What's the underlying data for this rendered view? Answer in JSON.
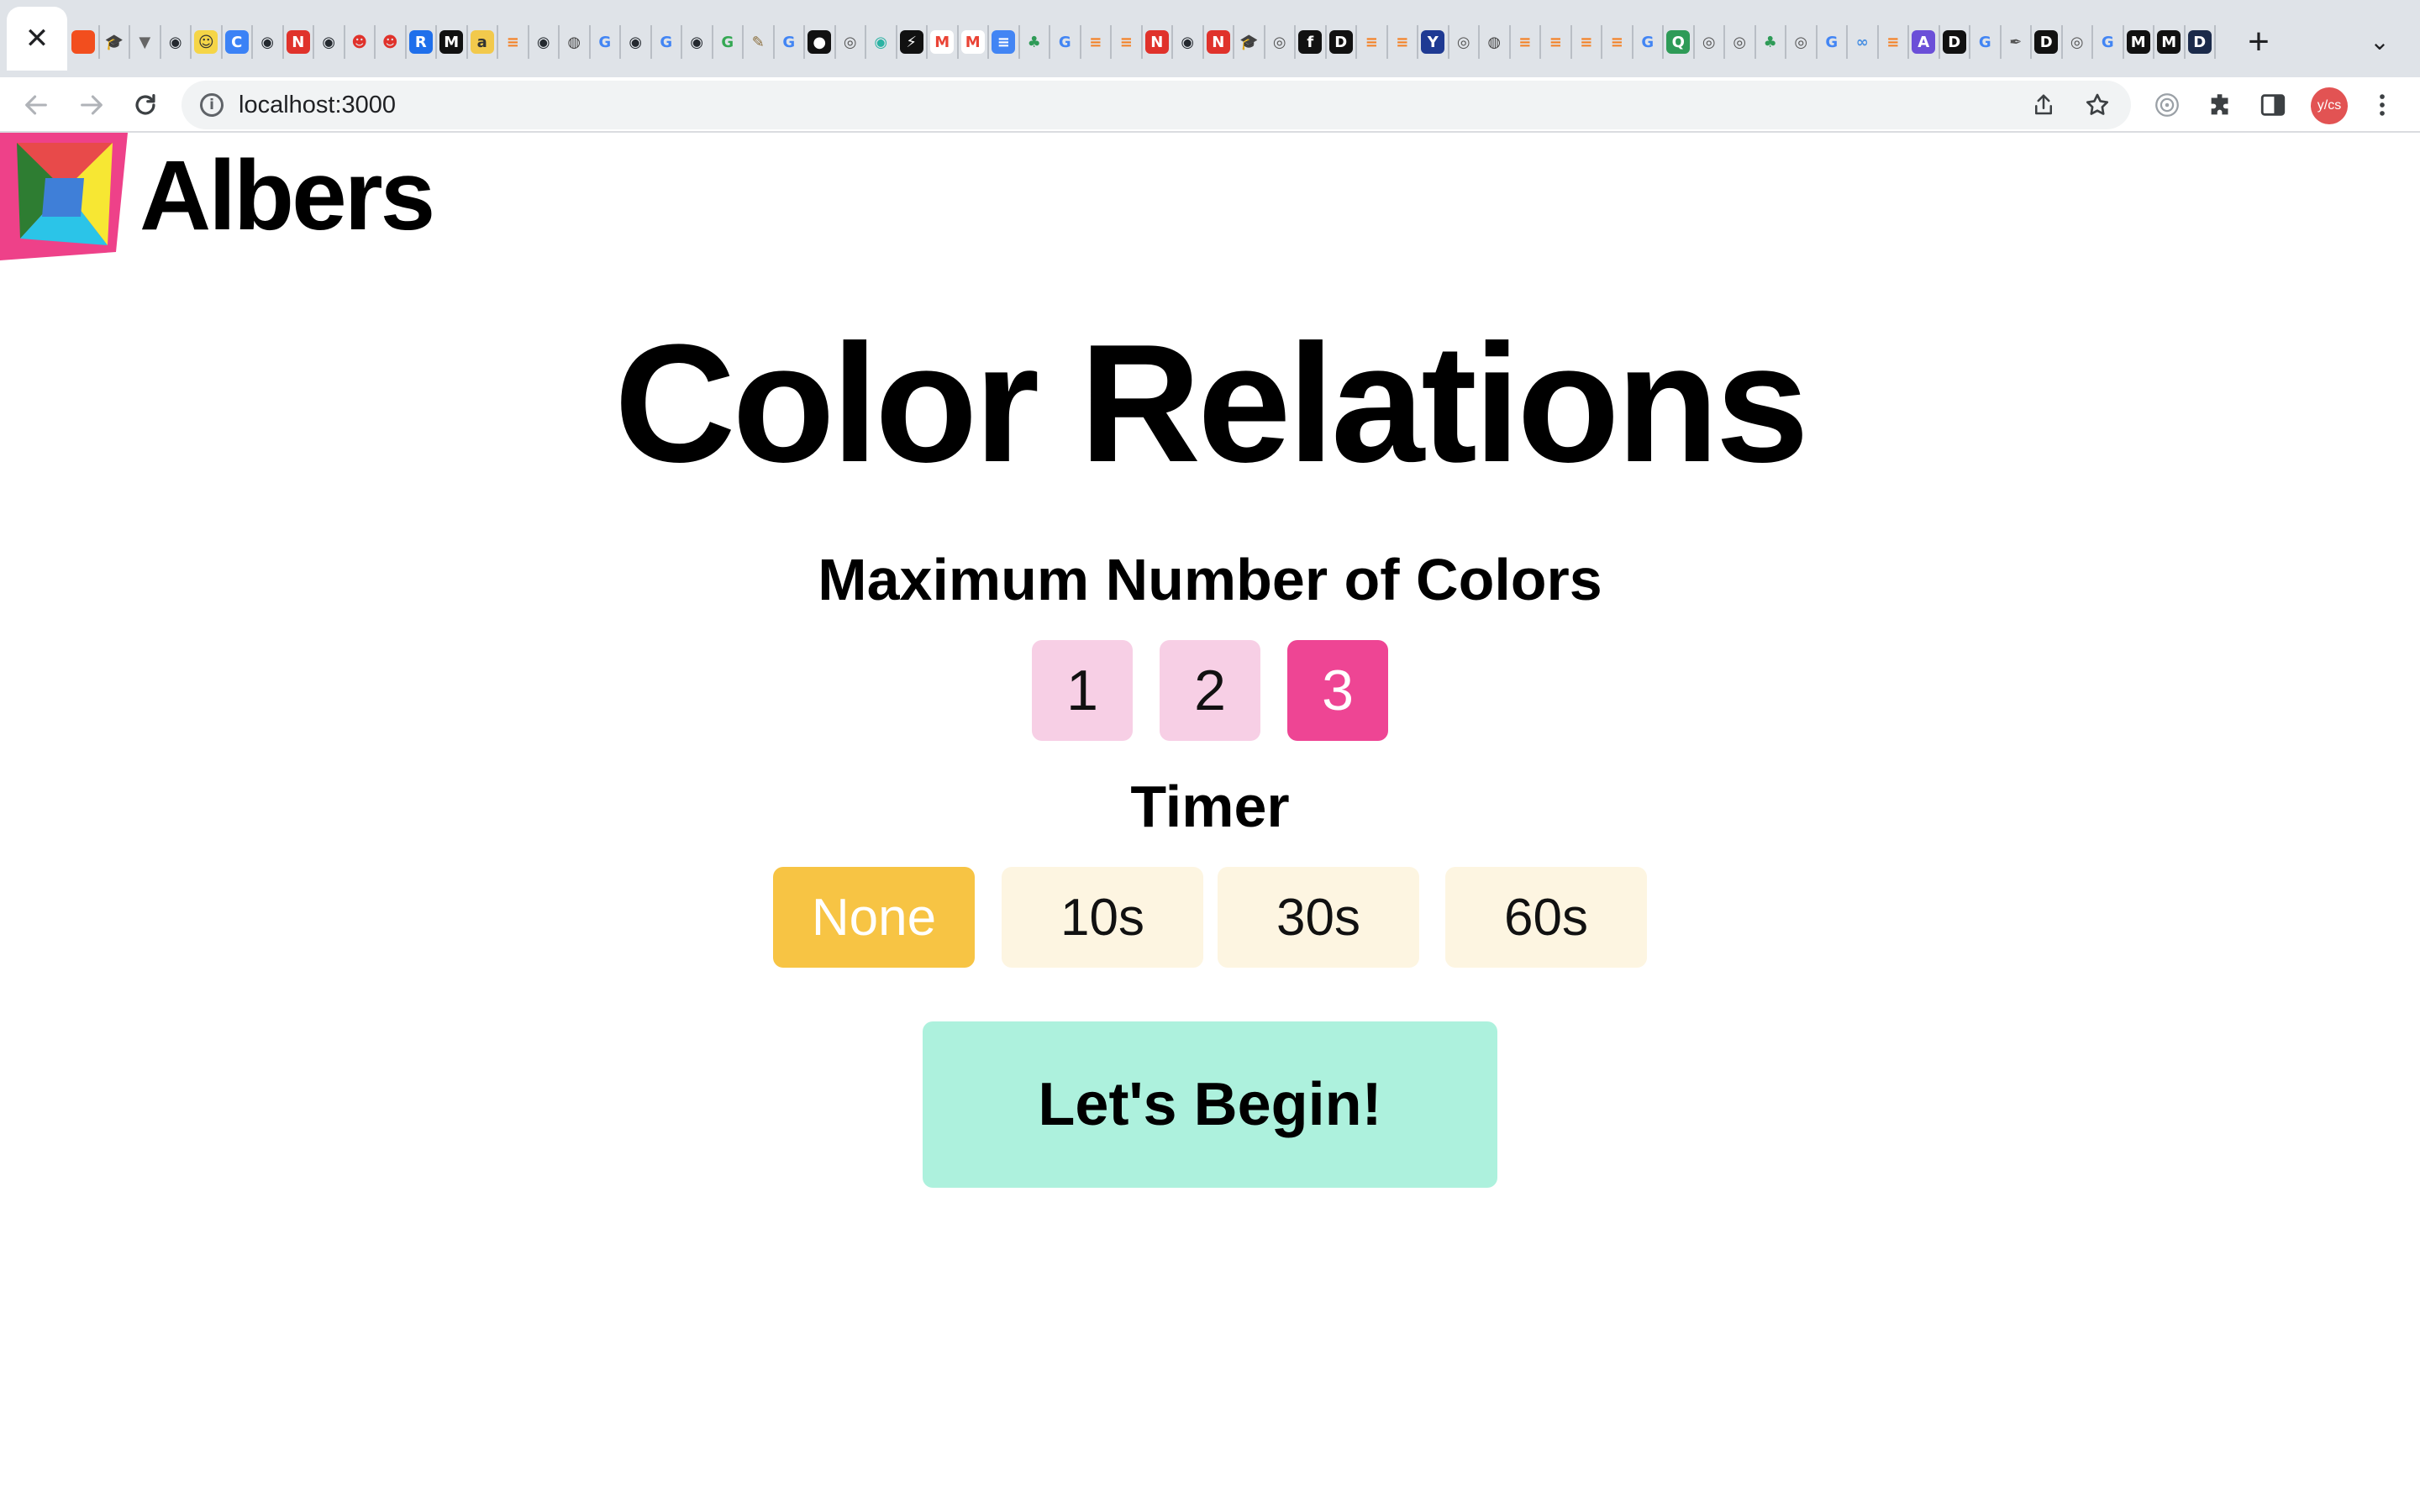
{
  "browser": {
    "tab_close_glyph": "✕",
    "new_tab_glyph": "+",
    "tab_menu_glyph": "⌄",
    "url": "localhost:3000",
    "favicons": [
      {
        "name": "figma",
        "glyph": "",
        "bg": "#f24e1e",
        "fg": "#ffffff"
      },
      {
        "name": "scholar",
        "glyph": "🎓",
        "bg": "#dfe3e8",
        "fg": "#333333"
      },
      {
        "name": "vercel",
        "glyph": "▼",
        "bg": "#dfe3e8",
        "fg": "#666666"
      },
      {
        "name": "github",
        "glyph": "◉",
        "bg": "#dfe3e8",
        "fg": "#24292f"
      },
      {
        "name": "emoji",
        "glyph": "☺",
        "bg": "#f5d547",
        "fg": "#333333"
      },
      {
        "name": "c-app",
        "glyph": "C",
        "bg": "#3b82f6",
        "fg": "#ffffff"
      },
      {
        "name": "github",
        "glyph": "◉",
        "bg": "#dfe3e8",
        "fg": "#24292f"
      },
      {
        "name": "notion",
        "glyph": "N",
        "bg": "#e0322b",
        "fg": "#ffffff"
      },
      {
        "name": "github",
        "glyph": "◉",
        "bg": "#dfe3e8",
        "fg": "#24292f"
      },
      {
        "name": "palette",
        "glyph": "☻",
        "bg": "#dfe3e8",
        "fg": "#e0322b"
      },
      {
        "name": "palette",
        "glyph": "☻",
        "bg": "#dfe3e8",
        "fg": "#e0322b"
      },
      {
        "name": "r-app",
        "glyph": "R",
        "bg": "#1f6feb",
        "fg": "#ffffff"
      },
      {
        "name": "medium",
        "glyph": "M",
        "bg": "#111111",
        "fg": "#ffffff"
      },
      {
        "name": "bird",
        "glyph": "a",
        "bg": "#f2c94c",
        "fg": "#333333"
      },
      {
        "name": "stack",
        "glyph": "≡",
        "bg": "#dfe3e8",
        "fg": "#f48024"
      },
      {
        "name": "github",
        "glyph": "◉",
        "bg": "#dfe3e8",
        "fg": "#24292f"
      },
      {
        "name": "globe",
        "glyph": "◍",
        "bg": "#dfe3e8",
        "fg": "#444444"
      },
      {
        "name": "google",
        "glyph": "G",
        "bg": "#dfe3e8",
        "fg": "#4285f4"
      },
      {
        "name": "github",
        "glyph": "◉",
        "bg": "#dfe3e8",
        "fg": "#24292f"
      },
      {
        "name": "google",
        "glyph": "G",
        "bg": "#dfe3e8",
        "fg": "#4285f4"
      },
      {
        "name": "github",
        "glyph": "◉",
        "bg": "#dfe3e8",
        "fg": "#24292f"
      },
      {
        "name": "google",
        "glyph": "G",
        "bg": "#dfe3e8",
        "fg": "#34a853"
      },
      {
        "name": "misc",
        "glyph": "✎",
        "bg": "#dfe3e8",
        "fg": "#8a6d3b"
      },
      {
        "name": "google",
        "glyph": "G",
        "bg": "#dfe3e8",
        "fg": "#4285f4"
      },
      {
        "name": "medium",
        "glyph": "●",
        "bg": "#111111",
        "fg": "#ffffff"
      },
      {
        "name": "chrome",
        "glyph": "◎",
        "bg": "#dfe3e8",
        "fg": "#555555"
      },
      {
        "name": "eye",
        "glyph": "◉",
        "bg": "#dfe3e8",
        "fg": "#2bb3a3"
      },
      {
        "name": "bolt",
        "glyph": "⚡",
        "bg": "#111111",
        "fg": "#ffffff"
      },
      {
        "name": "gmail",
        "glyph": "M",
        "bg": "#ffffff",
        "fg": "#ea4335"
      },
      {
        "name": "gmail",
        "glyph": "M",
        "bg": "#ffffff",
        "fg": "#ea4335"
      },
      {
        "name": "docs",
        "glyph": "≡",
        "bg": "#4285f4",
        "fg": "#ffffff"
      },
      {
        "name": "tree",
        "glyph": "♣",
        "bg": "#dfe3e8",
        "fg": "#2e9b57"
      },
      {
        "name": "google",
        "glyph": "G",
        "bg": "#dfe3e8",
        "fg": "#4285f4"
      },
      {
        "name": "stack",
        "glyph": "≡",
        "bg": "#dfe3e8",
        "fg": "#f48024"
      },
      {
        "name": "stack",
        "glyph": "≡",
        "bg": "#dfe3e8",
        "fg": "#f48024"
      },
      {
        "name": "notion",
        "glyph": "N",
        "bg": "#e0322b",
        "fg": "#ffffff"
      },
      {
        "name": "github",
        "glyph": "◉",
        "bg": "#dfe3e8",
        "fg": "#24292f"
      },
      {
        "name": "notion",
        "glyph": "N",
        "bg": "#e0322b",
        "fg": "#ffffff"
      },
      {
        "name": "scholar",
        "glyph": "🎓",
        "bg": "#dfe3e8",
        "fg": "#333333"
      },
      {
        "name": "chrome",
        "glyph": "◎",
        "bg": "#dfe3e8",
        "fg": "#555555"
      },
      {
        "name": "f-app",
        "glyph": "f",
        "bg": "#111111",
        "fg": "#ffffff"
      },
      {
        "name": "dev",
        "glyph": "D",
        "bg": "#111111",
        "fg": "#ffffff"
      },
      {
        "name": "stack",
        "glyph": "≡",
        "bg": "#dfe3e8",
        "fg": "#f48024"
      },
      {
        "name": "stack",
        "glyph": "≡",
        "bg": "#dfe3e8",
        "fg": "#f48024"
      },
      {
        "name": "yale",
        "glyph": "Y",
        "bg": "#1f3a93",
        "fg": "#ffffff"
      },
      {
        "name": "chrome",
        "glyph": "◎",
        "bg": "#dfe3e8",
        "fg": "#555555"
      },
      {
        "name": "globe",
        "glyph": "◍",
        "bg": "#dfe3e8",
        "fg": "#444444"
      },
      {
        "name": "stack",
        "glyph": "≡",
        "bg": "#dfe3e8",
        "fg": "#f48024"
      },
      {
        "name": "stack",
        "glyph": "≡",
        "bg": "#dfe3e8",
        "fg": "#f48024"
      },
      {
        "name": "stack",
        "glyph": "≡",
        "bg": "#dfe3e8",
        "fg": "#f48024"
      },
      {
        "name": "stack",
        "glyph": "≡",
        "bg": "#dfe3e8",
        "fg": "#f48024"
      },
      {
        "name": "google",
        "glyph": "G",
        "bg": "#dfe3e8",
        "fg": "#4285f4"
      },
      {
        "name": "q-app",
        "glyph": "Q",
        "bg": "#2e9b57",
        "fg": "#ffffff"
      },
      {
        "name": "chrome",
        "glyph": "◎",
        "bg": "#dfe3e8",
        "fg": "#555555"
      },
      {
        "name": "chrome",
        "glyph": "◎",
        "bg": "#dfe3e8",
        "fg": "#555555"
      },
      {
        "name": "tree",
        "glyph": "♣",
        "bg": "#dfe3e8",
        "fg": "#2e9b57"
      },
      {
        "name": "chrome",
        "glyph": "◎",
        "bg": "#dfe3e8",
        "fg": "#555555"
      },
      {
        "name": "google",
        "glyph": "G",
        "bg": "#dfe3e8",
        "fg": "#4285f4"
      },
      {
        "name": "infinity",
        "glyph": "∞",
        "bg": "#dfe3e8",
        "fg": "#4a90e2"
      },
      {
        "name": "stack",
        "glyph": "≡",
        "bg": "#dfe3e8",
        "fg": "#f48024"
      },
      {
        "name": "a-app",
        "glyph": "A",
        "bg": "#6b4fd8",
        "fg": "#ffffff"
      },
      {
        "name": "dev",
        "glyph": "D",
        "bg": "#111111",
        "fg": "#ffffff"
      },
      {
        "name": "google",
        "glyph": "G",
        "bg": "#dfe3e8",
        "fg": "#4285f4"
      },
      {
        "name": "feather",
        "glyph": "✒",
        "bg": "#dfe3e8",
        "fg": "#555555"
      },
      {
        "name": "dev",
        "glyph": "D",
        "bg": "#111111",
        "fg": "#ffffff"
      },
      {
        "name": "chrome",
        "glyph": "◎",
        "bg": "#dfe3e8",
        "fg": "#555555"
      },
      {
        "name": "google",
        "glyph": "G",
        "bg": "#dfe3e8",
        "fg": "#4285f4"
      },
      {
        "name": "medium",
        "glyph": "M",
        "bg": "#111111",
        "fg": "#ffffff"
      },
      {
        "name": "medium",
        "glyph": "M",
        "bg": "#111111",
        "fg": "#ffffff"
      },
      {
        "name": "d-app",
        "glyph": "D",
        "bg": "#1b2a4a",
        "fg": "#ffffff"
      }
    ]
  },
  "brand": {
    "name": "Albers",
    "logo_colors": {
      "outer": "#ee4189",
      "top": "#e84a4a",
      "left": "#2e7d32",
      "right": "#f7e733",
      "bottom": "#2bc4e8",
      "center": "#3f7fd8"
    }
  },
  "page": {
    "title": "Color Relations",
    "colors_section": {
      "label": "Maximum Number of Colors",
      "options": [
        "1",
        "2",
        "3"
      ],
      "selected": "3",
      "selected_color": "#ee4594",
      "unselected_color": "#f7cfe5",
      "selected_text_color": "#ffffff",
      "unselected_text_color": "#111111"
    },
    "timer_section": {
      "label": "Timer",
      "options": [
        "None",
        "10s",
        "30s",
        "60s"
      ],
      "selected": "None",
      "selected_color": "#f7c444",
      "unselected_color": "#fdf5e1",
      "selected_text_color": "#ffffff",
      "unselected_text_color": "#111111"
    },
    "begin_button": "Let's Begin!",
    "begin_color": "#adf1dd"
  }
}
